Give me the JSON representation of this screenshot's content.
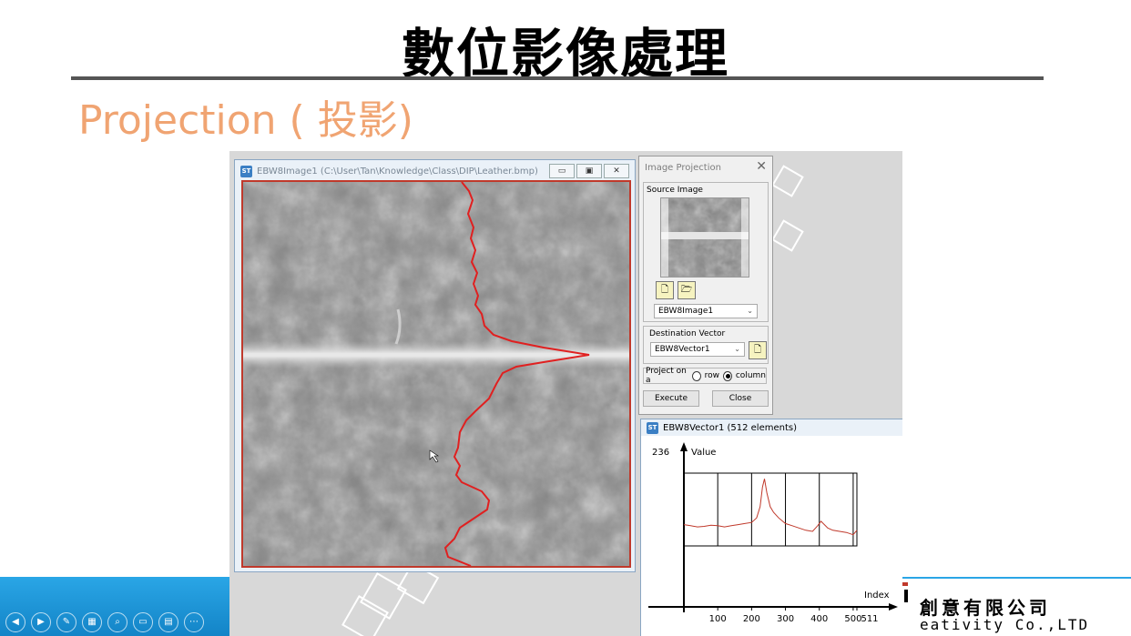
{
  "slide": {
    "title": "數位影像處理",
    "subtitle": "Projection ( 投影)",
    "logo_line1": "創意有限公司",
    "logo_line2": "eativity Co.,LTD"
  },
  "image_window": {
    "title": "EBW8Image1 (C:\\User\\Tan\\Knowledge\\Class\\DIP\\Leather.bmp)",
    "icon": "ST",
    "buttons": [
      "minimize-icon",
      "restore-icon",
      "close-icon"
    ]
  },
  "projection_dialog": {
    "title": "Image Projection",
    "close": "✕",
    "source_label": "Source Image",
    "source_select": "EBW8Image1",
    "dest_label": "Destination Vector",
    "dest_select": "EBW8Vector1",
    "project_on": "Project on a",
    "opt_row": "row",
    "opt_column": "column",
    "selected": "column",
    "execute": "Execute",
    "close_btn": "Close"
  },
  "vector_window": {
    "title": "EBW8Vector1 (512 elements)",
    "icon": "ST",
    "y_max_label": "236",
    "y_axis_label": "Value",
    "x_axis_label": "Index",
    "x_ticks": [
      "100",
      "200",
      "300",
      "400",
      "500",
      "511"
    ]
  },
  "chart_data": {
    "type": "line",
    "title": "",
    "xlabel": "Index",
    "ylabel": "Value",
    "xlim": [
      0,
      511
    ],
    "ylim": [
      0,
      236
    ],
    "x_ticks": [
      100,
      200,
      300,
      400,
      500,
      511
    ],
    "series": [
      {
        "color": "#c0392b",
        "x": [
          0,
          20,
          40,
          60,
          80,
          100,
          120,
          140,
          160,
          180,
          200,
          215,
          225,
          232,
          238,
          245,
          255,
          265,
          280,
          300,
          320,
          340,
          360,
          380,
          395,
          405,
          415,
          425,
          440,
          460,
          480,
          500,
          511
        ],
        "y": [
          128,
          126,
          124,
          125,
          127,
          126,
          124,
          126,
          128,
          130,
          132,
          140,
          160,
          195,
          210,
          185,
          160,
          150,
          140,
          130,
          126,
          122,
          118,
          116,
          126,
          134,
          128,
          122,
          118,
          116,
          114,
          110,
          118
        ]
      }
    ]
  },
  "colors": {
    "subtitle": "#f0a472",
    "band": "#1f96d8",
    "projection_line": "#e02020"
  }
}
